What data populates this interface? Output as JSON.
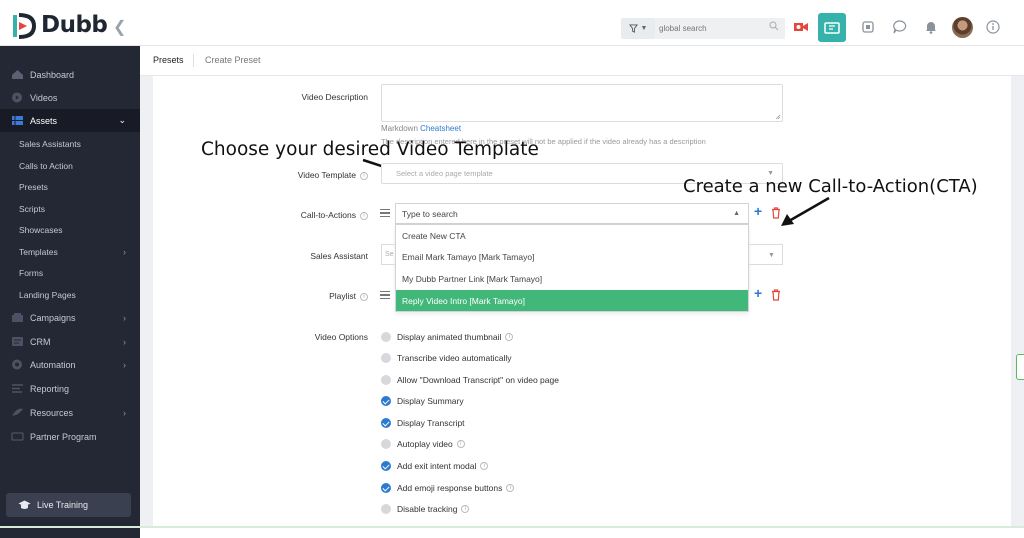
{
  "brand": {
    "name": "Dubb",
    "accent": "#35b3ab",
    "green": "#41b77a",
    "link": "#2d7bd1"
  },
  "topbar": {
    "search_placeholder": "global search"
  },
  "sidebar": {
    "items": [
      {
        "label": "Dashboard"
      },
      {
        "label": "Videos"
      },
      {
        "label": "Assets"
      },
      {
        "label": "Sales Assistants"
      },
      {
        "label": "Calls to Action"
      },
      {
        "label": "Presets"
      },
      {
        "label": "Scripts"
      },
      {
        "label": "Showcases"
      },
      {
        "label": "Templates"
      },
      {
        "label": "Forms"
      },
      {
        "label": "Landing Pages"
      },
      {
        "label": "Campaigns"
      },
      {
        "label": "CRM"
      },
      {
        "label": "Automation"
      },
      {
        "label": "Reporting"
      },
      {
        "label": "Resources"
      },
      {
        "label": "Partner Program"
      }
    ],
    "live_training": "Live Training"
  },
  "tabs": {
    "presets": "Presets",
    "create": "Create Preset"
  },
  "form": {
    "video_description_label": "Video Description",
    "markdown_prefix": "Markdown ",
    "markdown_link": "Cheatsheet",
    "desc_helper": "The description entered here in the preset will not be applied if the video already has a description",
    "video_template_label": "Video Template",
    "video_template_placeholder": "Select a video page template",
    "cta_label": "Call-to-Actions",
    "cta_search_placeholder": "Type to search",
    "cta_options": [
      "Create New CTA",
      "Email Mark Tamayo [Mark Tamayo]",
      "My Dubb Partner Link [Mark Tamayo]",
      "Reply Video Intro [Mark Tamayo]"
    ],
    "sales_assistant_label": "Sales Assistant",
    "sales_assistant_placeholder": "Se",
    "playlist_label": "Playlist",
    "video_options_label": "Video Options",
    "options": [
      {
        "label": "Display animated thumbnail",
        "checked": false,
        "info": true
      },
      {
        "label": "Transcribe video automatically",
        "checked": false,
        "info": false
      },
      {
        "label": "Allow \"Download Transcript\" on video page",
        "checked": false,
        "info": false
      },
      {
        "label": "Display Summary",
        "checked": true,
        "info": false
      },
      {
        "label": "Display Transcript",
        "checked": true,
        "info": false
      },
      {
        "label": "Autoplay video",
        "checked": false,
        "info": true
      },
      {
        "label": "Add exit intent modal",
        "checked": true,
        "info": true
      },
      {
        "label": "Add emoji response buttons",
        "checked": true,
        "info": true
      },
      {
        "label": "Disable tracking",
        "checked": false,
        "info": true
      }
    ]
  },
  "annotations": {
    "template": "Choose your desired Video Template",
    "cta": "Create a new Call-to-Action(CTA)"
  }
}
